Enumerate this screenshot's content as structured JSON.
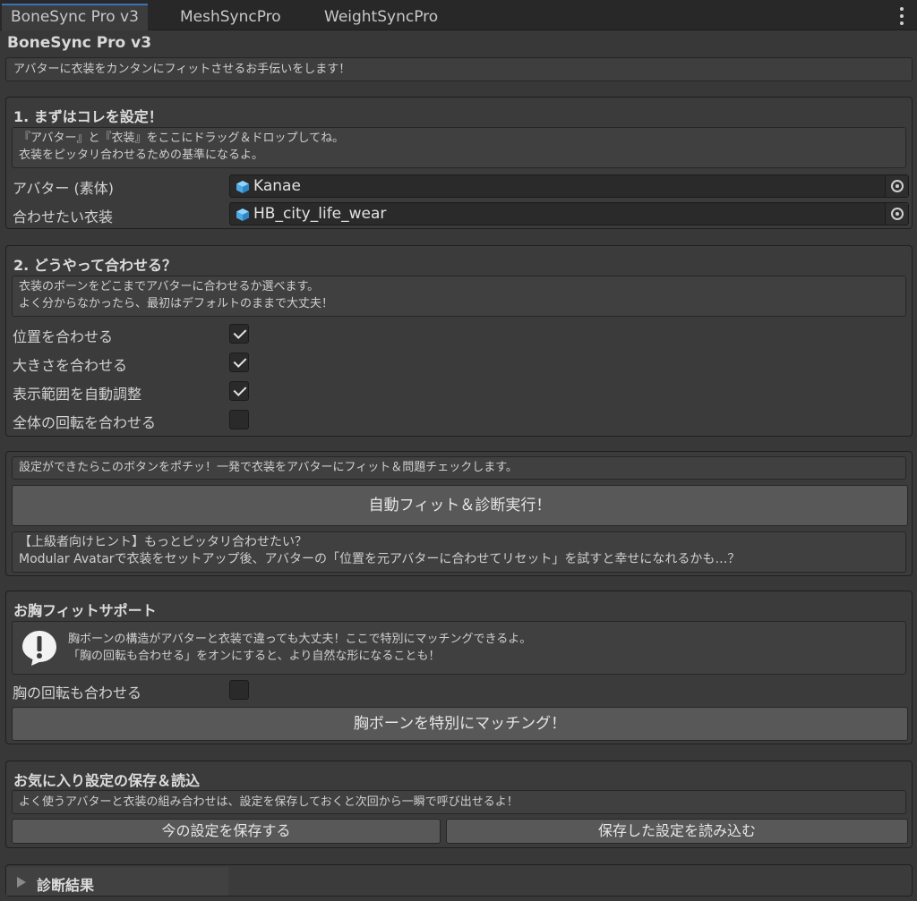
{
  "tabs": [
    {
      "label": "BoneSync Pro v3",
      "active": true
    },
    {
      "label": "MeshSyncPro",
      "active": false
    },
    {
      "label": "WeightSyncPro",
      "active": false
    }
  ],
  "header": {
    "title": "BoneSync Pro v3",
    "subtitle": "アバターに衣装をカンタンにフィットさせるお手伝いをします！"
  },
  "section1": {
    "heading": "1. まずはコレを設定！",
    "help_line1": "『アバター』と『衣装』をここにドラッグ＆ドロップしてね。",
    "help_line2": "衣装をピッタリ合わせるための基準になるよ。",
    "avatar_label": "アバター (素体)",
    "avatar_value": "Kanae",
    "costume_label": "合わせたい衣装",
    "costume_value": "HB_city_life_wear"
  },
  "section2": {
    "heading": "2. どうやって合わせる？",
    "help_line1": "衣装のボーンをどこまでアバターに合わせるか選べます。",
    "help_line2": "よく分からなかったら、最初はデフォルトのままで大丈夫！",
    "options": [
      {
        "label": "位置を合わせる",
        "checked": true
      },
      {
        "label": "大きさを合わせる",
        "checked": true
      },
      {
        "label": "表示範囲を自動調整",
        "checked": true
      },
      {
        "label": "全体の回転を合わせる",
        "checked": false
      }
    ]
  },
  "section3": {
    "help": "設定ができたらこのボタンをポチッ！一発で衣装をアバターにフィット＆問題チェックします。",
    "run_button": "自動フィット＆診断実行！",
    "tip_line1": "【上級者向けヒント】もっとピッタリ合わせたい？",
    "tip_line2": "Modular Avatarで衣装をセットアップ後、アバターの「位置を元アバターに合わせてリセット」を試すと幸せになれるかも…？"
  },
  "section4": {
    "heading": "お胸フィットサポート",
    "warn_line1": "胸ボーンの構造がアバターと衣装で違っても大丈夫！ここで特別にマッチングできるよ。",
    "warn_line2": "「胸の回転も合わせる」をオンにすると、より自然な形になることも！",
    "chest_rot_label": "胸の回転も合わせる",
    "chest_rot_checked": false,
    "match_button": "胸ボーンを特別にマッチング！"
  },
  "section5": {
    "heading": "お気に入り設定の保存＆読込",
    "help": "よく使うアバターと衣装の組み合わせは、設定を保存しておくと次回から一瞬で呼び出せるよ！",
    "save_button": "今の設定を保存する",
    "load_button": "保存した設定を読み込む"
  },
  "results": {
    "label": "診断結果",
    "expanded": false
  },
  "icons": {
    "menu": "kebab-menu-icon",
    "object": "prefab-cube-icon",
    "picker": "object-picker-icon",
    "warning": "warning-exclamation-icon",
    "foldout": "foldout-triangle-icon"
  },
  "colors": {
    "tab_accent": "#3a72b8",
    "cube_blue": "#5fb6ee"
  }
}
